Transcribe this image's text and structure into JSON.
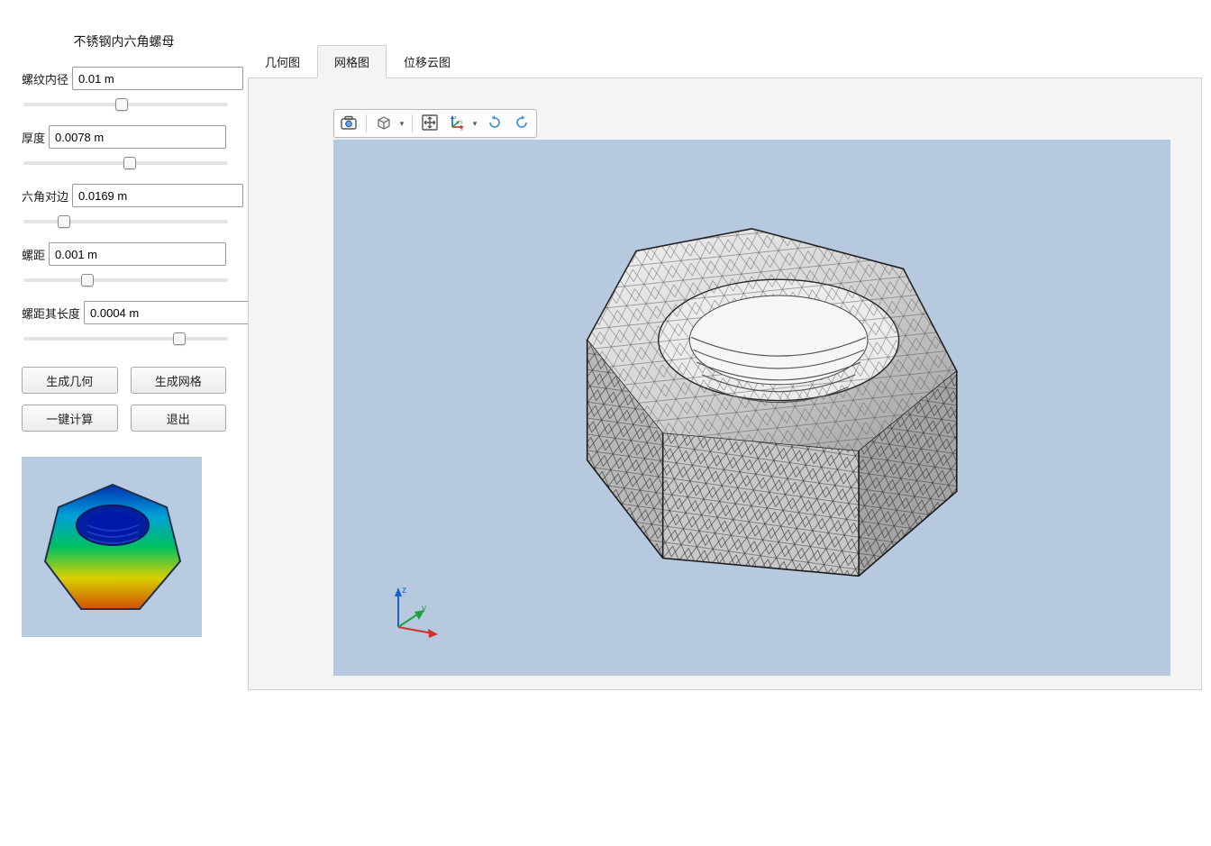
{
  "sidebar": {
    "title": "不锈钢内六角螺母",
    "params": [
      {
        "label": "螺纹内径",
        "value": "0.01 m",
        "slider": 48
      },
      {
        "label": "厚度",
        "value": "0.0078 m",
        "slider": 52
      },
      {
        "label": "六角对边",
        "value": "0.0169 m",
        "slider": 18
      },
      {
        "label": "螺距",
        "value": "0.001 m",
        "slider": 30
      },
      {
        "label": "螺距其长度",
        "value": "0.0004 m",
        "slider": 78
      }
    ],
    "buttons": {
      "gen_geom": "生成几何",
      "gen_mesh": "生成网格",
      "compute": "一键计算",
      "exit": "退出"
    }
  },
  "tabs": {
    "items": [
      {
        "label": "几何图",
        "id": "geometry"
      },
      {
        "label": "网格图",
        "id": "mesh"
      },
      {
        "label": "位移云图",
        "id": "displacement"
      }
    ],
    "active": 1
  },
  "toolbar": {
    "screenshot": "screenshot",
    "view_cube": "view-cube",
    "move": "move",
    "axes": "axes-select",
    "rotate_cw": "rotate-cw",
    "rotate_ccw": "rotate-ccw"
  },
  "viewport": {
    "bg": "#b6c9de",
    "axes": {
      "x": "x",
      "y": "y",
      "z": "z"
    }
  }
}
